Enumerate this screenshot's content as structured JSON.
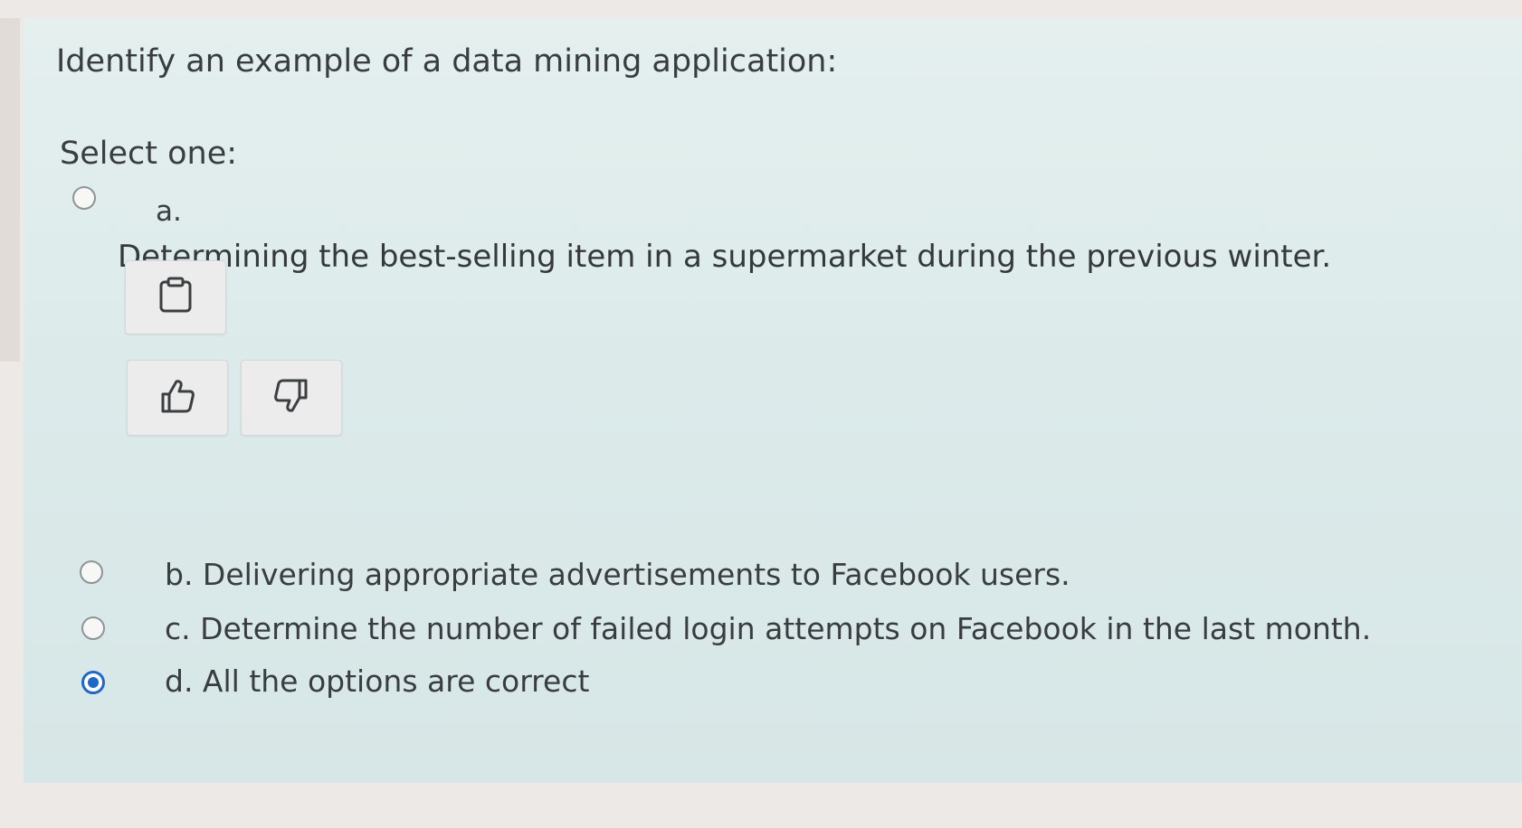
{
  "question": {
    "text": "Identify an example of a data mining application:",
    "prompt": "Select one:"
  },
  "options": [
    {
      "letter": "a.",
      "text": "Determining the best-selling item in a supermarket during the previous winter.",
      "selected": false
    },
    {
      "text": "b. Delivering appropriate advertisements to Facebook users.",
      "selected": false
    },
    {
      "text": "c. Determine the number of failed login attempts on Facebook in the last month.",
      "selected": false
    },
    {
      "text": "d. All the options are correct",
      "selected": true
    }
  ],
  "toolbar_icons": [
    "clipboard-icon",
    "thumbs-up-icon",
    "thumbs-down-icon"
  ],
  "colors": {
    "card_background": "#dcebea",
    "radio_selected": "#1f67c9",
    "text": "#3a3d3f"
  }
}
